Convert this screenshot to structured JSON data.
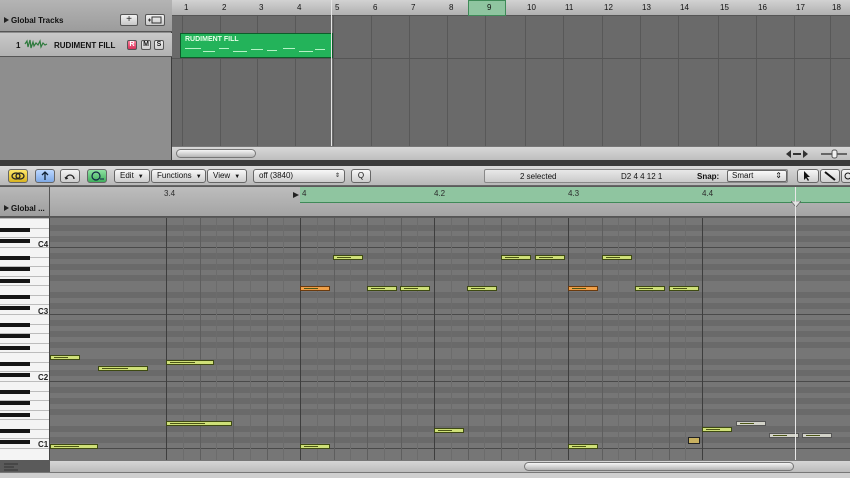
{
  "arrange": {
    "global_tracks_label": "Global Tracks",
    "add_track_label": "+",
    "track": {
      "number": "1",
      "name": "RUDIMENT FILL",
      "r": "R",
      "m": "M",
      "s": "S"
    },
    "bars": [
      "1",
      "2",
      "3",
      "4",
      "5",
      "6",
      "7",
      "8",
      "9",
      "10",
      "11",
      "12",
      "13",
      "14",
      "15",
      "16",
      "17",
      "18"
    ],
    "region_name": "RUDIMENT FILL"
  },
  "toolbar": {
    "edit": "Edit",
    "functions": "Functions",
    "view": "View",
    "quantize": "off (3840)",
    "q_button": "Q",
    "selected": "2 selected",
    "note_info": "D2   4 4 12 1",
    "snap_label": "Snap:",
    "snap_value": "Smart"
  },
  "piano_roll": {
    "global_label": "Global ...",
    "beats": [
      "3.4",
      "4",
      "4.2",
      "4.3",
      "4.4"
    ],
    "octaves": [
      "C4",
      "C3",
      "C2",
      "C1"
    ]
  },
  "colors": {
    "region": "#23b35a",
    "note": "#cfe078",
    "selected_note": "#f0a048",
    "cycle": "#8fc5a0"
  }
}
